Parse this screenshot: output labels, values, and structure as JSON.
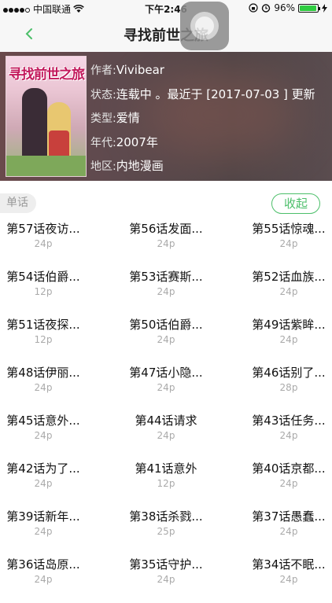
{
  "status_bar": {
    "carrier": "中国联通",
    "time": "下午2:46",
    "battery": "96%",
    "battery_level": 0.96
  },
  "nav": {
    "title": "寻找前世之旅"
  },
  "comic": {
    "cover_text": "寻找前世之旅",
    "rows": [
      {
        "key": "作者:",
        "value": "Vivibear"
      },
      {
        "key": "状态:",
        "value": "连载中 。最近于 [2017-07-03 ] 更新"
      },
      {
        "key": "类型:",
        "value": "爱情"
      },
      {
        "key": "年代:",
        "value": "2007年"
      },
      {
        "key": "地区:",
        "value": "内地漫画"
      }
    ]
  },
  "section": {
    "label": "单话",
    "collapse_label": "收起"
  },
  "chapters": [
    {
      "title": "第57话夜访...",
      "pages": "24p"
    },
    {
      "title": "第56话发面...",
      "pages": "24p"
    },
    {
      "title": "第55话惊魂...",
      "pages": "24p"
    },
    {
      "title": "第54话伯爵...",
      "pages": "12p"
    },
    {
      "title": "第53话赛斯...",
      "pages": "24p"
    },
    {
      "title": "第52话血族...",
      "pages": "24p"
    },
    {
      "title": "第51话夜探...",
      "pages": "12p"
    },
    {
      "title": "第50话伯爵...",
      "pages": "24p"
    },
    {
      "title": "第49话紫眸...",
      "pages": "24p"
    },
    {
      "title": "第48话伊丽...",
      "pages": "24p"
    },
    {
      "title": "第47话小隐...",
      "pages": "24p"
    },
    {
      "title": "第46话别了...",
      "pages": "28p"
    },
    {
      "title": "第45话意外...",
      "pages": "24p"
    },
    {
      "title": "第44话请求",
      "pages": "24p"
    },
    {
      "title": "第43话任务...",
      "pages": "24p"
    },
    {
      "title": "第42话为了...",
      "pages": "24p"
    },
    {
      "title": "第41话意外",
      "pages": "12p"
    },
    {
      "title": "第40话京都...",
      "pages": "24p"
    },
    {
      "title": "第39话新年...",
      "pages": "24p"
    },
    {
      "title": "第38话杀戮...",
      "pages": "25p"
    },
    {
      "title": "第37话愚蠢...",
      "pages": "24p"
    },
    {
      "title": "第36话岛原...",
      "pages": "24p"
    },
    {
      "title": "第35话守护...",
      "pages": "24p"
    },
    {
      "title": "第34话不眠...",
      "pages": "24p"
    }
  ],
  "colors": {
    "accent": "#4cbf6a"
  }
}
